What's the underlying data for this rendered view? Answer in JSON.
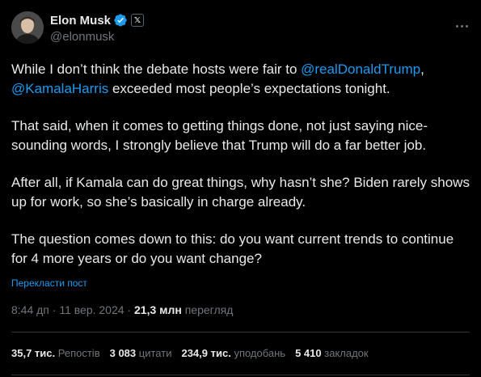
{
  "author": {
    "display_name": "Elon Musk",
    "handle": "@elonmusk",
    "verified_color": "#1d9bf0",
    "affiliate_badge": "𝕏"
  },
  "tweet": {
    "p1": {
      "t1": "While I don’t think the debate hosts were fair to ",
      "m1": "@realDonaldTrump",
      "t2": ", ",
      "m2": "@KamalaHarris",
      "t3": " exceeded most people’s expectations tonight."
    },
    "p2": "That said, when it comes to getting things done, not just saying nice-sounding words, I strongly believe that Trump will do a far better job.",
    "p3": "After all, if Kamala can do great things, why hasn’t she? Biden rarely shows up for work, so she’s basically in charge already.",
    "p4": "The question comes down to this: do you want current trends to continue for 4 more years or do you want change?",
    "translate_label": "Перекласти пост"
  },
  "meta": {
    "time": "8:44 дп",
    "sep": " · ",
    "date": "11 вер. 2024",
    "views_count": "21,3 млн",
    "views_label": "перегляд"
  },
  "stats": {
    "reposts_num": "35,7 тис.",
    "reposts_label": "Репостів",
    "quotes_num": "3 083",
    "quotes_label": "цитати",
    "likes_num": "234,9 тис.",
    "likes_label": "уподобань",
    "bookmarks_num": "5 410",
    "bookmarks_label": "закладок"
  },
  "colors": {
    "background": "#000000",
    "text": "#e7e9ea",
    "secondary": "#71767b",
    "link": "#1d9bf0"
  }
}
